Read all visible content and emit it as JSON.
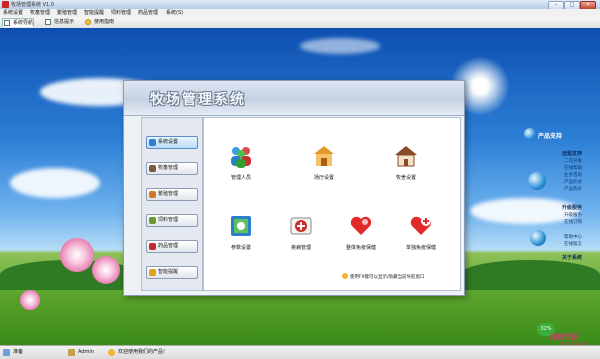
{
  "window": {
    "title": "牧场管理系统 V1.0",
    "controls": {
      "minimize": "–",
      "maximize": "□",
      "close": "✕"
    }
  },
  "menu": [
    "系统设置",
    "牧畜管理",
    "繁殖管理",
    "智能提醒",
    "饲料管理",
    "药品管理",
    "系统(S)"
  ],
  "tabs": [
    {
      "label": "系统导航",
      "icon": "navigation-icon"
    },
    {
      "label": "信息提示",
      "icon": "info-icon"
    },
    {
      "label": "使用指南",
      "icon": "help-icon"
    }
  ],
  "dialog": {
    "title": "牧场管理系统",
    "nav": [
      {
        "label": "系统设置",
        "icon": "settings-icon",
        "color": "#2f7fd0",
        "active": true
      },
      {
        "label": "牧畜管理",
        "icon": "livestock-icon",
        "color": "#7a5b3a"
      },
      {
        "label": "繁殖管理",
        "icon": "breeding-icon",
        "color": "#d07a2a"
      },
      {
        "label": "饲料管理",
        "icon": "feed-icon",
        "color": "#6a9a2a"
      },
      {
        "label": "药品管理",
        "icon": "medicine-icon",
        "color": "#c22a2a"
      },
      {
        "label": "智能提醒",
        "icon": "reminder-icon",
        "color": "#e0a020"
      }
    ],
    "tiles": [
      {
        "label": "管理人员",
        "icon": "users-icon"
      },
      {
        "label": "场厅设置",
        "icon": "barn-icon"
      },
      {
        "label": "牧舍设置",
        "icon": "house-icon"
      },
      {
        "label": "参数设置",
        "icon": "parameters-icon"
      },
      {
        "label": "疾病管理",
        "icon": "disease-icon"
      },
      {
        "label": "整体免疫保健",
        "icon": "immunity-heart-icon"
      },
      {
        "label": "单独免疫保健",
        "icon": "single-heart-icon"
      }
    ],
    "hint": "使用F9键可以显示/隐藏当前导航窗口"
  },
  "side_panel": {
    "title": "产品支持",
    "sections": [
      {
        "heading": "远程支持",
        "links": [
          "二次开发",
          "在线帮助",
          "业务咨询",
          "产品形式",
          "产品购买"
        ]
      },
      {
        "heading": "升级服务",
        "links": [
          "升级服务",
          "在线订购"
        ]
      },
      {
        "heading": "",
        "links": [
          "帮助中心",
          "在线留言"
        ]
      },
      {
        "heading": "关于系统",
        "links": []
      }
    ],
    "percent": "32%"
  },
  "status": {
    "state": "准备",
    "user": "Admin",
    "message": "欢迎使用我们的产品!"
  },
  "watermark": {
    "text": "绿色资源",
    "sub": "www.jb51.net"
  }
}
